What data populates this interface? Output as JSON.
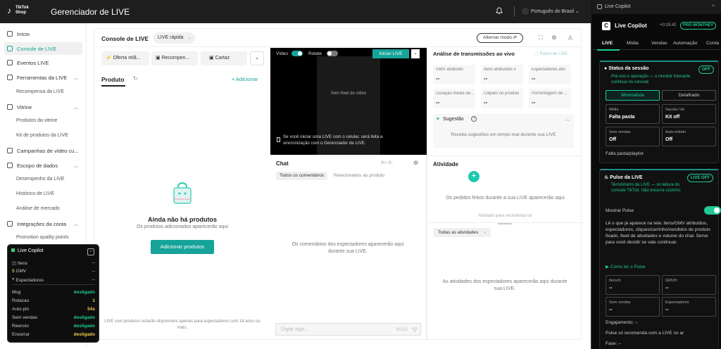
{
  "topbar": {
    "logo_text_1": "TikTok",
    "logo_text_2": "Shop",
    "title": "Gerenciador de LIVE",
    "language": "Português do Brasil"
  },
  "sidebar": {
    "items": [
      {
        "label": "Início"
      },
      {
        "label": "Console de LIVE"
      },
      {
        "label": "Eventos LIVE"
      },
      {
        "label": "Ferramentas da LIVE"
      },
      {
        "label": "Recompensa da LIVE"
      },
      {
        "label": "Vitrine"
      },
      {
        "label": "Produtos da vitrine"
      },
      {
        "label": "Kit de produtos da LIVE"
      },
      {
        "label": "Campanhas de vídeo cu..."
      },
      {
        "label": "Escopo de dados"
      },
      {
        "label": "Desempenho da LIVE"
      },
      {
        "label": "Histórico de LIVE"
      },
      {
        "label": "Análise de mercado"
      },
      {
        "label": "Integrações da conta"
      },
      {
        "label": "Promotion quality points"
      }
    ]
  },
  "console": {
    "title": "Console de LIVE",
    "mode": "LIVE rápida",
    "alt_mode": "Alternar modo"
  },
  "tools": {
    "btn1": "Oferta relâ...",
    "btn2": "Recompen...",
    "btn3": "Cartaz"
  },
  "products": {
    "tab": "Produto",
    "add": "+ Adicionar",
    "empty_title": "Ainda não há produtos",
    "empty_sub": "Os produtos adicionados aparecerão aqui",
    "add_button": "Adicionar produtos",
    "note": "LIVE com produtos estarão disponíveis apenas para espectadores com 18 anos ou mais."
  },
  "video": {
    "video_label": "Vídeo",
    "rotate_label": "Rotate",
    "start_button": "Iniciar LIVE",
    "no_feed": "Sem feed de vídeo",
    "note": "Se você iniciar uma LIVE com o celular, será feita a sincronização com o Gerenciador de LIVE."
  },
  "chat": {
    "title": "Chat",
    "font_tools": "A+  A-",
    "tab_all": "Todos os comentários",
    "tab_product": "Relacionados ao produto",
    "empty": "Os comentários dos espectadores aparecerão aqui durante sua LIVE.",
    "placeholder": "Digite algo...",
    "count": "0/150"
  },
  "analysis": {
    "title": "Análise de transmissões ao vivo",
    "link": "Painel de LIVE",
    "metrics": [
      {
        "label": "GMV atribuído",
        "value": "--"
      },
      {
        "label": "Itens atribuídos v",
        "value": "--"
      },
      {
        "label": "Espectadores ativ",
        "value": "--"
      },
      {
        "label": "Duração média de...",
        "value": "--"
      },
      {
        "label": "Cliques no produto",
        "value": "--"
      },
      {
        "label": "Porcentagem de ...",
        "value": "--"
      }
    ],
    "suggestion_title": "Sugestão",
    "suggestion_text": "Receba sugestões em tempo real durante sua LIVE"
  },
  "activity": {
    "title": "Atividade",
    "empty_top": "Os pedidos feitos durante a sua LIVE aparecerão aqui",
    "attest": "Atestado para recimentas lar",
    "filter": "Todas as atividades",
    "empty_bottom": "As atividades dos espectadores aparecerão aqui durante sua LIVE."
  },
  "mini_panel": {
    "title": "Live Copilot",
    "min": "-",
    "rows_top": [
      {
        "label": "Itens",
        "value": "--"
      },
      {
        "label": "GMV",
        "value": "--"
      },
      {
        "label": "Espectadores",
        "value": "--"
      }
    ],
    "rows_bottom": [
      {
        "label": "Msg",
        "value": "desligado"
      },
      {
        "label": "Rotacao",
        "value": "1"
      },
      {
        "label": "Auto-pin",
        "value": "54s"
      },
      {
        "label": "Sem vendas",
        "value": "desligado"
      },
      {
        "label": "Reenvio",
        "value": "desligado"
      },
      {
        "label": "Encerrar",
        "value": "desligado"
      }
    ]
  },
  "copilot": {
    "window_title": "Live Copilot",
    "title": "Live Copilot",
    "time": "+0:15:42",
    "plan": "PRO MONTHEY",
    "tabs": [
      "LIVE",
      "Mídia",
      "Vendas",
      "Automação",
      "Conta"
    ],
    "status": {
      "title": "Status da sessão",
      "badge": "OFF",
      "sub": "Pré-voo e operação — o monitor futurante continua no console",
      "seg1": "Minimalista",
      "seg2": "Detalhado",
      "stats": [
        {
          "label": "Mídia",
          "value": "Falta pasta"
        },
        {
          "label": "Sacola / kit",
          "value": "Kit off"
        },
        {
          "label": "Sem vendas",
          "value": "Off"
        },
        {
          "label": "Auto-inibido",
          "value": "Off"
        }
      ],
      "footer": "Falta pasta/playlist"
    },
    "pulse": {
      "title": "Pulse da LIVE",
      "badge": "LIVE OFF",
      "sub": "Termômetro da LIVE — só leitura do console TikTok. Não encerra sozinho.",
      "toggle_label": "Mostrar Pulse",
      "desc": "Lê o que já aparece na tela: itens/GMV atribuídos, espectadores, cliques/carrinho/vendidos de produto fixado, feed de atividades e volume do chat. Serve para você decidir se vale continuar.",
      "link": "▶ Como ler o Pulse",
      "stats": [
        {
          "label": "Itens/h",
          "value": "--"
        },
        {
          "label": "GMV/h",
          "value": "--"
        },
        {
          "label": "Sem vendas",
          "value": "--"
        },
        {
          "label": "Espectadores",
          "value": "--"
        }
      ],
      "engagement": "Engajamento: --",
      "recommend": "Pulse só recomenda com a LIVE no ar",
      "phase": "Fase: --"
    }
  }
}
